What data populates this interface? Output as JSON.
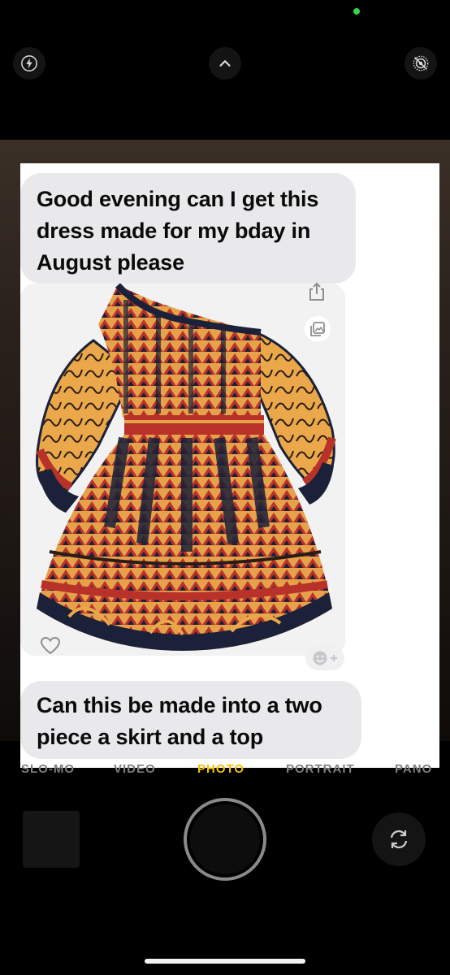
{
  "messages": [
    {
      "text": "Good evening can I get this dress made for my bday in August please"
    },
    {
      "text": "Can this be made into a two piece a skirt and a top"
    }
  ],
  "camera_modes": [
    "SLO-MO",
    "VIDEO",
    "PHOTO",
    "PORTRAIT",
    "PANO"
  ],
  "active_mode": "PHOTO",
  "icons": {
    "flash": "flash-icon",
    "chevron": "chevron-up-icon",
    "live_photo": "live-photo-off-icon",
    "share": "share-icon",
    "gallery": "gallery-icon",
    "heart": "heart-icon",
    "react": "add-reaction-icon",
    "flip": "flip-camera-icon"
  },
  "colors": {
    "bubble": "#e9e9eb",
    "status_dot": "#37d34a",
    "active_mode": "#f2c200"
  }
}
